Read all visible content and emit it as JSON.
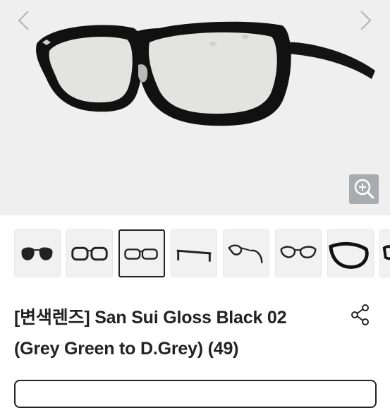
{
  "gallery": {
    "prev_icon": "chevron-left-icon",
    "next_icon": "chevron-right-icon",
    "zoom_icon": "zoom-in-icon",
    "image": "black-square-eyeglasses-photo",
    "thumbnails": [
      {
        "label": "thumbnail-1",
        "selected": false
      },
      {
        "label": "thumbnail-2",
        "selected": false
      },
      {
        "label": "thumbnail-3",
        "selected": true
      },
      {
        "label": "thumbnail-4",
        "selected": false
      },
      {
        "label": "thumbnail-5",
        "selected": false
      },
      {
        "label": "thumbnail-6",
        "selected": false
      },
      {
        "label": "thumbnail-7",
        "selected": false
      },
      {
        "label": "thumbnail-8",
        "selected": false
      }
    ]
  },
  "product": {
    "title_line1": "[변색렌즈] San Sui Gloss Black 02",
    "title_line2": "(Grey Green to D.Grey) (49)",
    "share_icon": "share-icon"
  },
  "colors": {
    "hero_bg": "#efefef",
    "zoom_bg": "#a8acaf",
    "text": "#222222"
  }
}
